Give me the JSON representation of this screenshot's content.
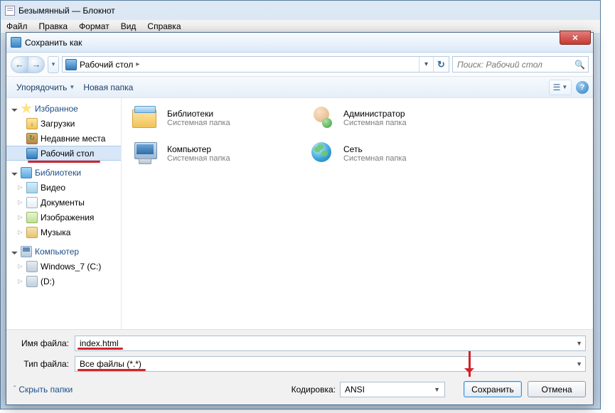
{
  "notepad": {
    "title": "Безымянный — Блокнот",
    "menu": [
      "Файл",
      "Правка",
      "Формат",
      "Вид",
      "Справка"
    ]
  },
  "dialog": {
    "title": "Сохранить как",
    "breadcrumb": {
      "location": "Рабочий стол"
    },
    "search": {
      "placeholder": "Поиск: Рабочий стол"
    },
    "toolbar": {
      "organize": "Упорядочить",
      "newfolder": "Новая папка"
    }
  },
  "tree": {
    "favorites": {
      "label": "Избранное",
      "items": [
        {
          "label": "Загрузки",
          "icon": "downloads"
        },
        {
          "label": "Недавние места",
          "icon": "recent"
        },
        {
          "label": "Рабочий стол",
          "icon": "desktop",
          "selected": true
        }
      ]
    },
    "libraries": {
      "label": "Библиотеки",
      "items": [
        {
          "label": "Видео",
          "icon": "video"
        },
        {
          "label": "Документы",
          "icon": "docs"
        },
        {
          "label": "Изображения",
          "icon": "images"
        },
        {
          "label": "Музыка",
          "icon": "music"
        }
      ]
    },
    "computer": {
      "label": "Компьютер",
      "items": [
        {
          "label": "Windows_7 (C:)",
          "icon": "drive"
        },
        {
          "label": "(D:)",
          "icon": "drive"
        }
      ]
    }
  },
  "items": [
    {
      "name": "Библиотеки",
      "sub": "Системная папка",
      "icon": "libraries"
    },
    {
      "name": "Администратор",
      "sub": "Системная папка",
      "icon": "admin"
    },
    {
      "name": "Компьютер",
      "sub": "Системная папка",
      "icon": "computer"
    },
    {
      "name": "Сеть",
      "sub": "Системная папка",
      "icon": "network"
    }
  ],
  "fields": {
    "filename_label": "Имя файла:",
    "filename_value": "index.html",
    "filetype_label": "Тип файла:",
    "filetype_value": "Все файлы (*.*)",
    "encoding_label": "Кодировка:",
    "encoding_value": "ANSI"
  },
  "actions": {
    "hide_folders": "Скрыть папки",
    "save": "Сохранить",
    "cancel": "Отмена"
  }
}
